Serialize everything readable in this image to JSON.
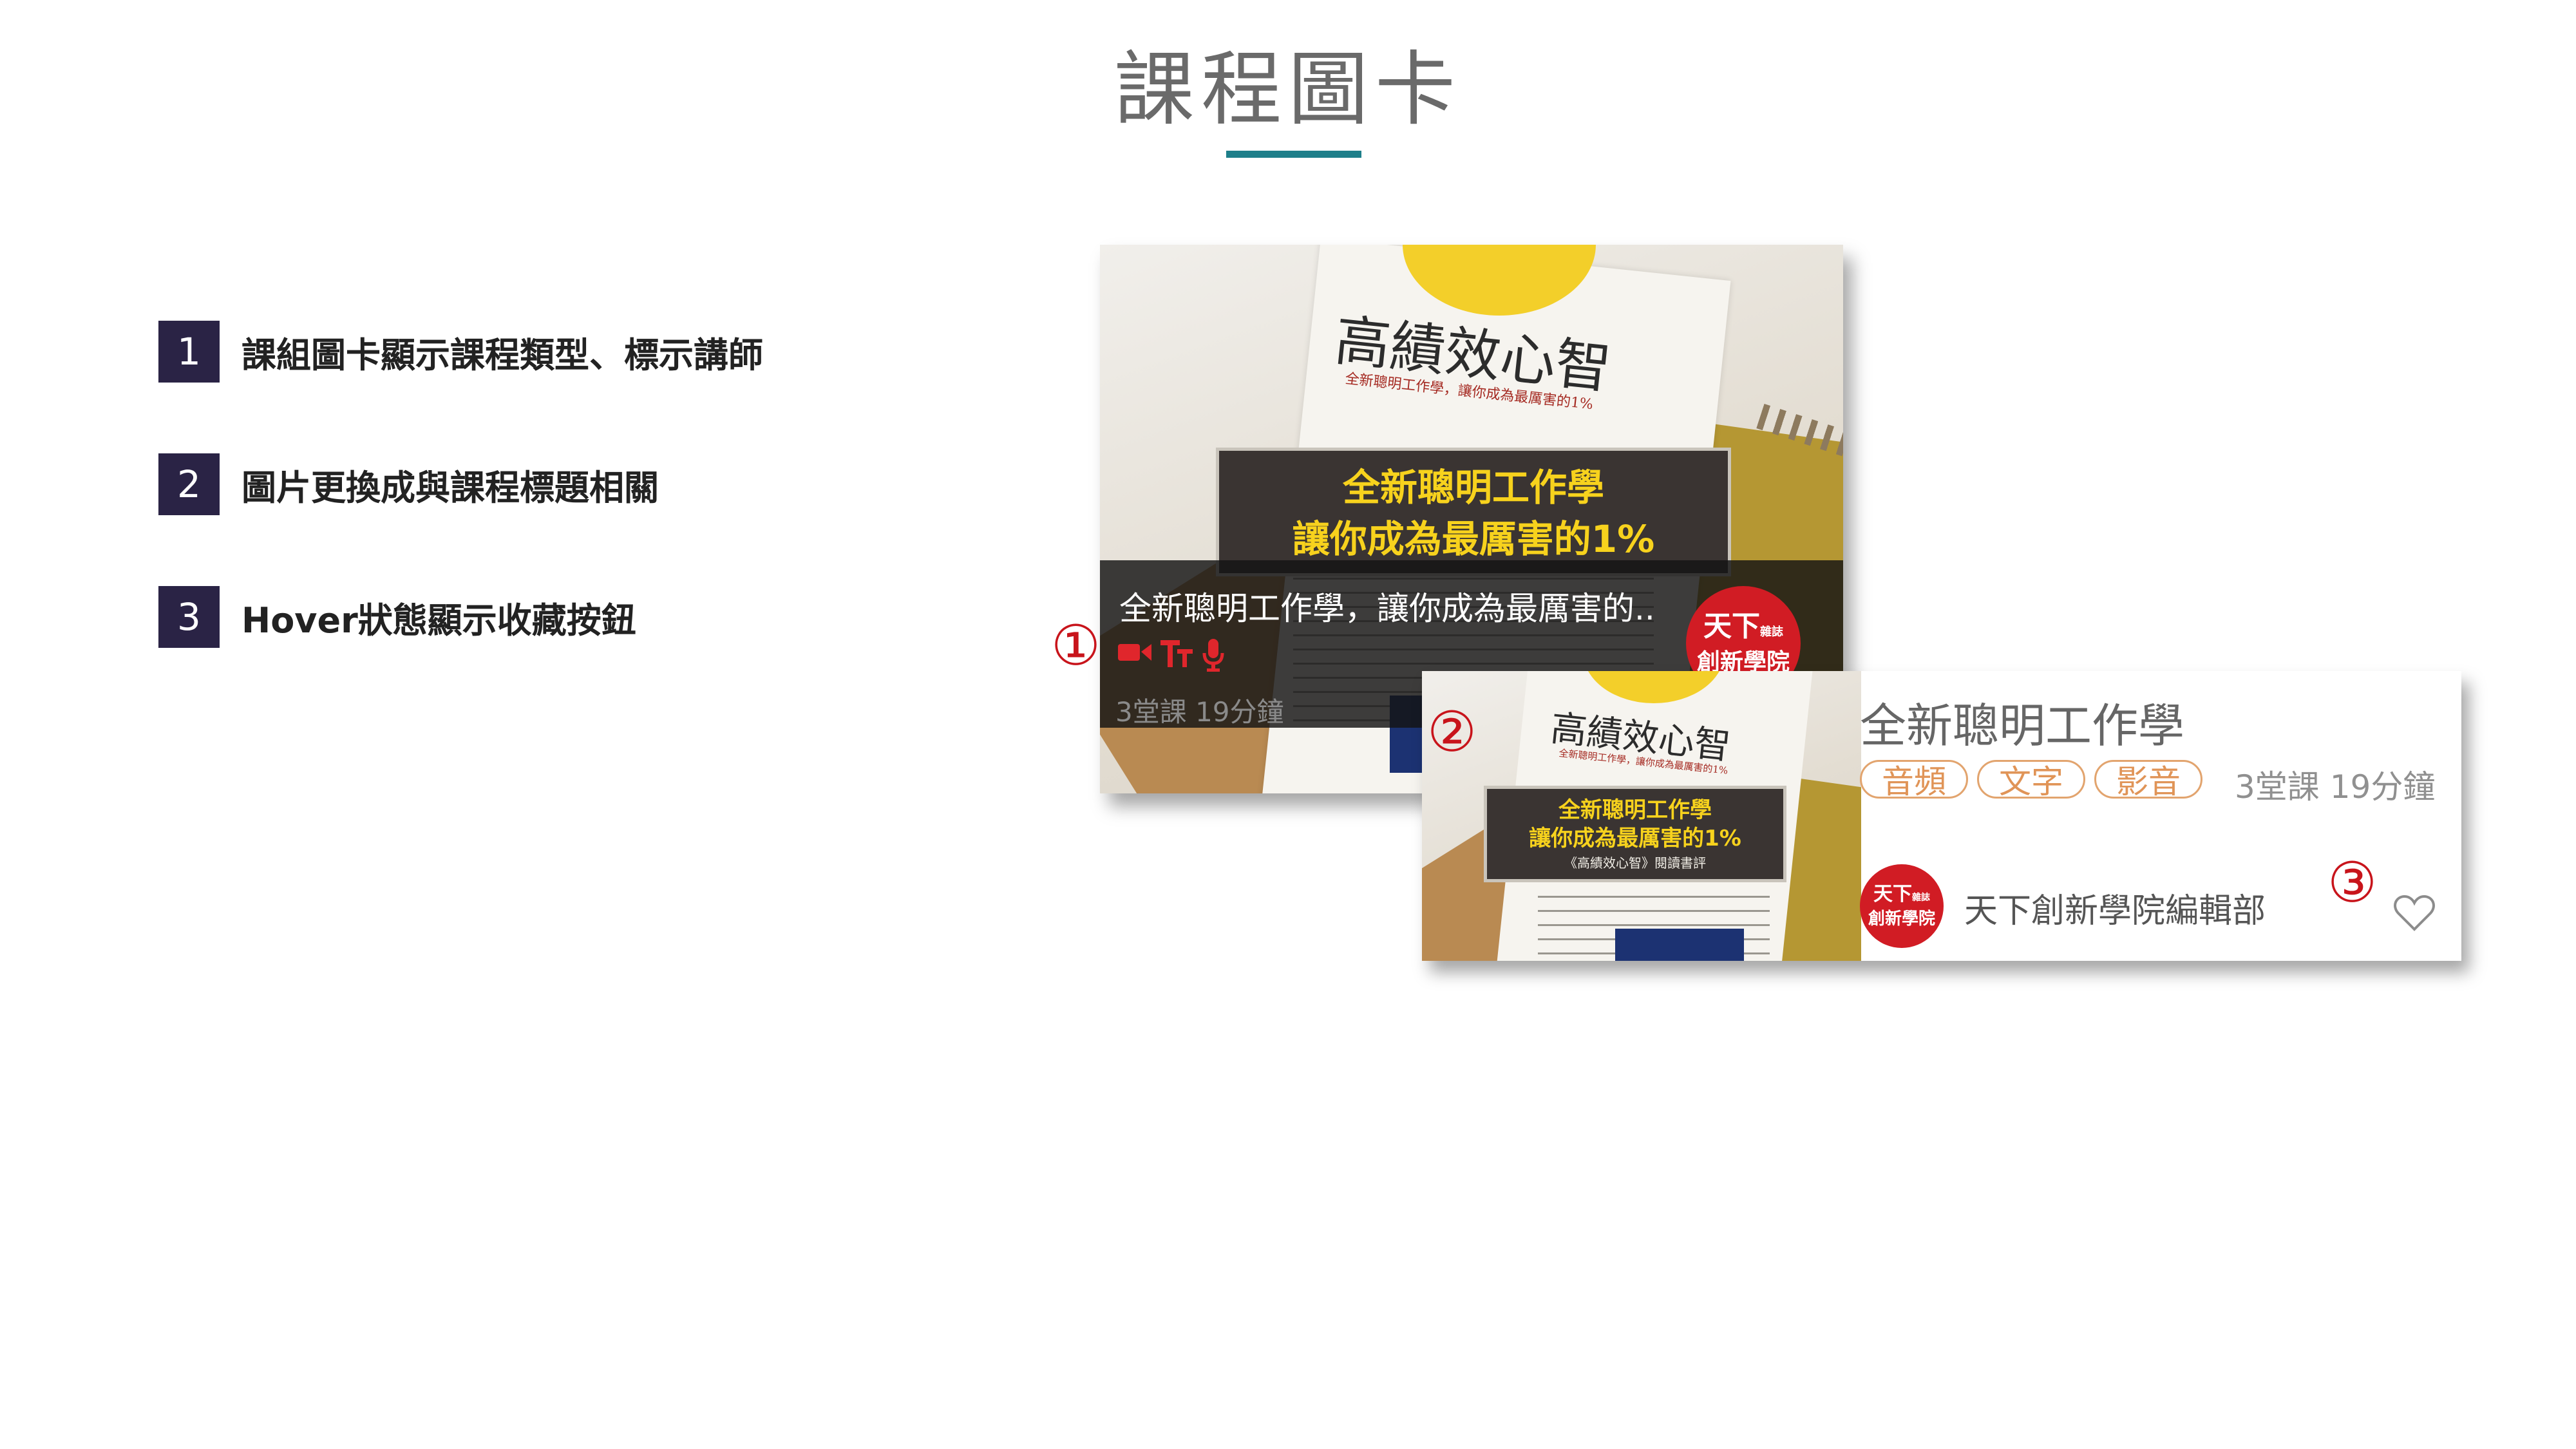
{
  "page": {
    "title": "課程圖卡"
  },
  "list": [
    {
      "num": "1",
      "text": "課組圖卡顯示課程類型、標示講師"
    },
    {
      "num": "2",
      "text": "圖片更換成與課程標題相關"
    },
    {
      "num": "3",
      "text": "Hover狀態顯示收藏按鈕"
    }
  ],
  "book": {
    "title": "高績效心智",
    "subtitle": "全新聰明工作學，讓你成為最厲害的1%",
    "banner_line1": "全新聰明工作學",
    "banner_line2": "讓你成為最厲害的1%",
    "banner_caption": "《高績效心智》閱讀書評"
  },
  "card1": {
    "title": "全新聰明工作學，讓你成為最厲害的..",
    "meta": "3堂課  19分鐘",
    "icons": [
      "video-icon",
      "text-icon",
      "microphone-icon"
    ],
    "logo_line1": "天下",
    "logo_small": "雜誌",
    "logo_line2": "創新學院"
  },
  "card2": {
    "title": "全新聰明工作學",
    "tags": [
      "音頻",
      "文字",
      "影音"
    ],
    "meta": "3堂課 19分鐘",
    "author": "天下創新學院編輯部",
    "logo_line1": "天下",
    "logo_small": "雜誌",
    "logo_line2": "創新學院"
  },
  "markers": [
    "①",
    "②",
    "③"
  ],
  "colors": {
    "accent": "#1e7f8a",
    "badge": "#2a2345",
    "marker": "#c8141b",
    "media_icon": "#e0262c",
    "tag": "#e09457",
    "logo": "#d11c24"
  }
}
